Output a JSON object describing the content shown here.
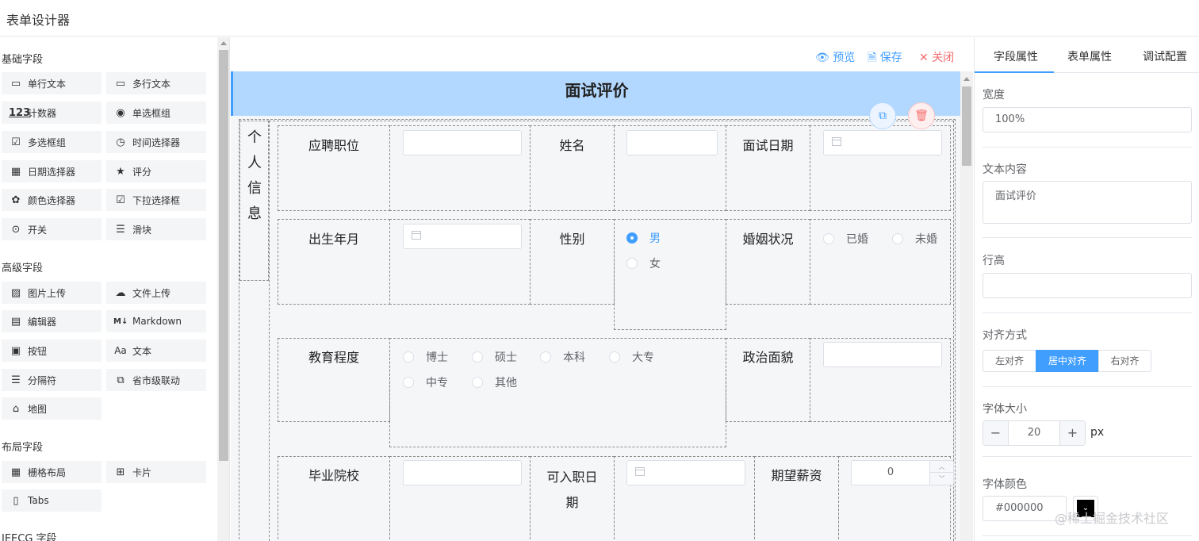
{
  "app": {
    "title": "表单设计器"
  },
  "left": {
    "groups": [
      {
        "title": "基础字段",
        "items": [
          {
            "label": "单行文本",
            "icon": "input-icon"
          },
          {
            "label": "多行文本",
            "icon": "textarea-icon"
          },
          {
            "label": "计数器",
            "icon": "number-icon"
          },
          {
            "label": "单选框组",
            "icon": "radio-icon"
          },
          {
            "label": "多选框组",
            "icon": "checkbox-icon"
          },
          {
            "label": "时间选择器",
            "icon": "clock-icon"
          },
          {
            "label": "日期选择器",
            "icon": "calendar-icon"
          },
          {
            "label": "评分",
            "icon": "star-icon"
          },
          {
            "label": "颜色选择器",
            "icon": "palette-icon"
          },
          {
            "label": "下拉选择框",
            "icon": "select-icon"
          },
          {
            "label": "开关",
            "icon": "switch-icon"
          },
          {
            "label": "滑块",
            "icon": "slider-icon"
          }
        ]
      },
      {
        "title": "高级字段",
        "items": [
          {
            "label": "图片上传",
            "icon": "image-icon"
          },
          {
            "label": "文件上传",
            "icon": "cloud-upload-icon"
          },
          {
            "label": "编辑器",
            "icon": "editor-icon"
          },
          {
            "label": "Markdown",
            "icon": "markdown-icon"
          },
          {
            "label": "按钮",
            "icon": "button-icon"
          },
          {
            "label": "文本",
            "icon": "text-icon"
          },
          {
            "label": "分隔符",
            "icon": "divider-icon"
          },
          {
            "label": "省市级联动",
            "icon": "cascader-icon"
          },
          {
            "label": "地图",
            "icon": "map-icon"
          }
        ]
      },
      {
        "title": "布局字段",
        "items": [
          {
            "label": "栅格布局",
            "icon": "grid-icon"
          },
          {
            "label": "卡片",
            "icon": "card-icon"
          },
          {
            "label": "Tabs",
            "icon": "tabs-icon"
          }
        ]
      },
      {
        "title": "JEECG 字段",
        "items": []
      }
    ]
  },
  "toolbar": {
    "preview": "预览",
    "save": "保存",
    "close": "关闭"
  },
  "form": {
    "title": "面试评价",
    "section": [
      "个",
      "人",
      "信",
      "息"
    ],
    "labels": {
      "position": "应聘职位",
      "name": "姓名",
      "interview_date": "面试日期",
      "birth": "出生年月",
      "gender": "性别",
      "marital": "婚姻状况",
      "education": "教育程度",
      "political": "政治面貌",
      "school": "毕业院校",
      "entry_date_1": "可入职日",
      "entry_date_2": "期",
      "salary": "期望薪资"
    },
    "gender_options": [
      "男",
      "女"
    ],
    "marital_options": [
      "已婚",
      "未婚"
    ],
    "education_options": [
      "博士",
      "硕士",
      "本科",
      "大专",
      "中专",
      "其他"
    ],
    "salary_value": "0"
  },
  "right": {
    "tabs": [
      "字段属性",
      "表单属性",
      "调试配置"
    ],
    "width_label": "宽度",
    "width_value": "100%",
    "text_label": "文本内容",
    "text_value": "面试评价",
    "line_height_label": "行高",
    "align_label": "对齐方式",
    "align_options": [
      "左对齐",
      "居中对齐",
      "右对齐"
    ],
    "font_size_label": "字体大小",
    "font_size_value": "20",
    "font_size_unit": "px",
    "font_color_label": "字体颜色",
    "font_color_value": "#000000"
  },
  "watermark": "@稀土掘金技术社区",
  "colors": {
    "accent": "#409eff",
    "danger": "#f56c6c",
    "title_bg": "#b3d8ff"
  }
}
